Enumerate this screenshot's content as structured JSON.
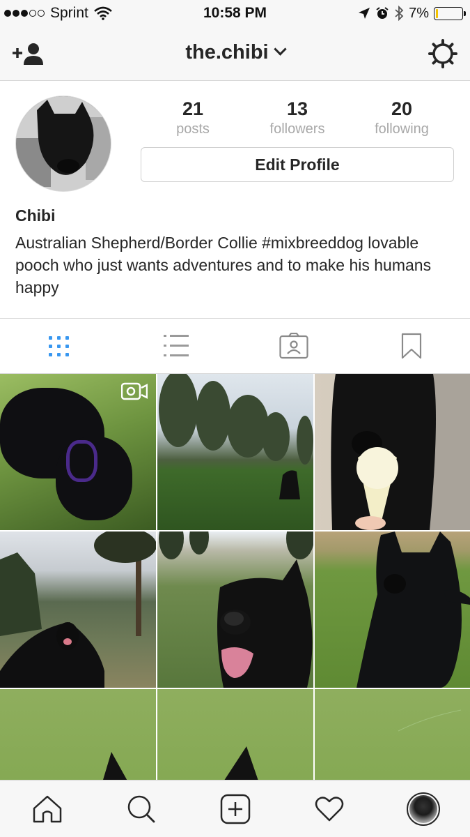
{
  "status_bar": {
    "carrier": "Sprint",
    "time": "10:58 PM",
    "battery_percent_label": "7%",
    "battery_level": 0.07,
    "signal_bars_filled": 3,
    "signal_bars_total": 5,
    "icons": [
      "wifi-icon",
      "location-arrow-icon",
      "alarm-icon",
      "bluetooth-icon",
      "battery-icon"
    ]
  },
  "nav": {
    "username": "the.chibi",
    "icons": [
      "add-person-icon",
      "chevron-down-icon",
      "gear-icon"
    ]
  },
  "profile": {
    "stats": [
      {
        "value": "21",
        "label": "posts"
      },
      {
        "value": "13",
        "label": "followers"
      },
      {
        "value": "20",
        "label": "following"
      }
    ],
    "edit_button_label": "Edit Profile",
    "name": "Chibi",
    "bio": "Australian Shepherd/Border Collie #mixbreeddog lovable pooch who just wants adventures and to make his humans happy"
  },
  "tabs": {
    "icons": [
      "grid-view-icon",
      "list-view-icon",
      "tagged-photos-icon",
      "saved-bookmark-icon"
    ],
    "active": "grid-view-icon"
  },
  "grid": {
    "columns": 3,
    "visible_rows": 3,
    "video_icon": "video-camera-icon"
  },
  "bottom_bar": {
    "icons": [
      "home-icon",
      "search-icon",
      "new-post-icon",
      "activity-heart-icon",
      "profile-avatar-icon"
    ]
  },
  "colors": {
    "accent_blue": "#3897f0",
    "text_primary": "#262626",
    "text_secondary": "#a8a8a8",
    "bar_background": "#f7f7f7",
    "battery_yellow": "#f5c400"
  }
}
